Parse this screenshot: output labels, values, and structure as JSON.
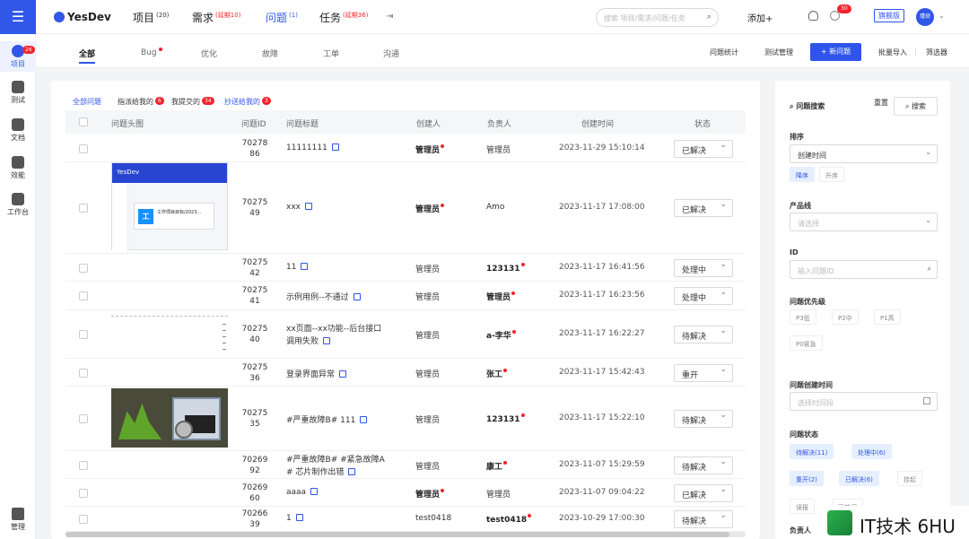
{
  "sidebar": {
    "items": [
      {
        "label": "项目",
        "badge": "26"
      },
      {
        "label": "测试"
      },
      {
        "label": "文档"
      },
      {
        "label": "效能"
      },
      {
        "label": "工作台"
      }
    ],
    "bottom": "管理"
  },
  "topnav": {
    "logo": "YesDev",
    "items": [
      {
        "label": "项目",
        "count": "(20)"
      },
      {
        "label": "需求",
        "count": "(延期10)"
      },
      {
        "label": "问题",
        "count": "(1)"
      },
      {
        "label": "任务",
        "count": "(延期36)"
      }
    ],
    "search_placeholder": "搜索 项目/需求/问题/任务",
    "add": "添加+",
    "badge": "30",
    "edition": "旗舰版",
    "avatar": "瑾琼"
  },
  "tabs": [
    "全部",
    "Bug",
    "优化",
    "故障",
    "工单",
    "沟通"
  ],
  "actions": {
    "stats": "问题统计",
    "test_mgmt": "测试管理",
    "new": "+ 新问题",
    "import": "批量导入",
    "filter": "筛选器"
  },
  "filters": [
    {
      "label": "全部问题"
    },
    {
      "label": "指派给我的",
      "badge": "6"
    },
    {
      "label": "我提交的",
      "badge": "34"
    },
    {
      "label": "抄送给我的",
      "badge": "3"
    }
  ],
  "columns": [
    "问题头图",
    "问题ID",
    "问题标题",
    "创建人",
    "负责人",
    "创建时间",
    "状态"
  ],
  "rows": [
    {
      "id1": "70278",
      "id2": "86",
      "title": "11111111",
      "creator": "管理员",
      "creatorBold": true,
      "owner": "管理员",
      "ownerBold": false,
      "time": "2023-11-29 15:10:14",
      "status": "已解决"
    },
    {
      "id1": "70275",
      "id2": "49",
      "title": "xxx",
      "creator": "管理员",
      "creatorBold": true,
      "owner": "Amo",
      "ownerBold": false,
      "time": "2023-11-17 17:08:00",
      "status": "已解决"
    },
    {
      "id1": "70275",
      "id2": "42",
      "title": "11",
      "creator": "管理员",
      "creatorBold": false,
      "owner": "123131",
      "ownerBold": true,
      "time": "2023-11-17 16:41:56",
      "status": "处理中"
    },
    {
      "id1": "70275",
      "id2": "41",
      "title": "示例用例--不通过",
      "creator": "管理员",
      "creatorBold": false,
      "owner": "管理员",
      "ownerBold": true,
      "time": "2023-11-17 16:23:56",
      "status": "处理中"
    },
    {
      "id1": "70275",
      "id2": "40",
      "title": "xx页面--xx功能--后台接口",
      "title2": "调用失败",
      "creator": "管理员",
      "creatorBold": false,
      "owner": "a-李华",
      "ownerBold": true,
      "time": "2023-11-17 16:22:27",
      "status": "待解决"
    },
    {
      "id1": "70275",
      "id2": "36",
      "title": "登录界面异常",
      "creator": "管理员",
      "creatorBold": false,
      "owner": "张工",
      "ownerBold": true,
      "time": "2023-11-17 15:42:43",
      "status": "重开"
    },
    {
      "id1": "70275",
      "id2": "35",
      "title": "#严重故障B# 111",
      "creator": "管理员",
      "creatorBold": false,
      "owner": "123131",
      "ownerBold": true,
      "time": "2023-11-17 15:22:10",
      "status": "待解决"
    },
    {
      "id1": "70269",
      "id2": "92",
      "title": "#严重故障B# #紧急故障A",
      "title2": "# 芯片制作出错",
      "creator": "管理员",
      "creatorBold": false,
      "owner": "康工",
      "ownerBold": true,
      "time": "2023-11-07 15:29:59",
      "status": "待解决"
    },
    {
      "id1": "70269",
      "id2": "60",
      "title": "aaaa",
      "creator": "管理员",
      "creatorBold": true,
      "owner": "管理员",
      "ownerBold": false,
      "time": "2023-11-07 09:04:22",
      "status": "已解决"
    },
    {
      "id1": "70266",
      "id2": "39",
      "title": "1",
      "creator": "test0418",
      "creatorBold": false,
      "owner": "test0418",
      "ownerBold": true,
      "time": "2023-10-29 17:00:30",
      "status": "待解决"
    }
  ],
  "thumb1": {
    "logo": "YesDev",
    "card_icon": "工",
    "card_title": "工作项目目标/2023..."
  },
  "panel": {
    "title": "问题搜索",
    "reset": "重置",
    "search": "搜索",
    "sort_label": "排序",
    "sort_value": "创建时间",
    "asc_desc": [
      "降序",
      "升序"
    ],
    "product_label": "产品线",
    "product_placeholder": "请选择",
    "id_label": "ID",
    "id_placeholder": "输入问题ID",
    "priority_label": "问题优先级",
    "priorities": [
      "P3低",
      "P2中",
      "P1高",
      "P0紧急"
    ],
    "created_label": "问题创建时间",
    "created_placeholder": "选择时间段",
    "state_label": "问题状态",
    "states": [
      "待解决(11)",
      "处理中(6)",
      "重开(2)",
      "已解决(6)",
      "挂起",
      "误报",
      "已关闭"
    ],
    "owner_label": "负责人"
  },
  "watermark": "IT技术 6HU"
}
